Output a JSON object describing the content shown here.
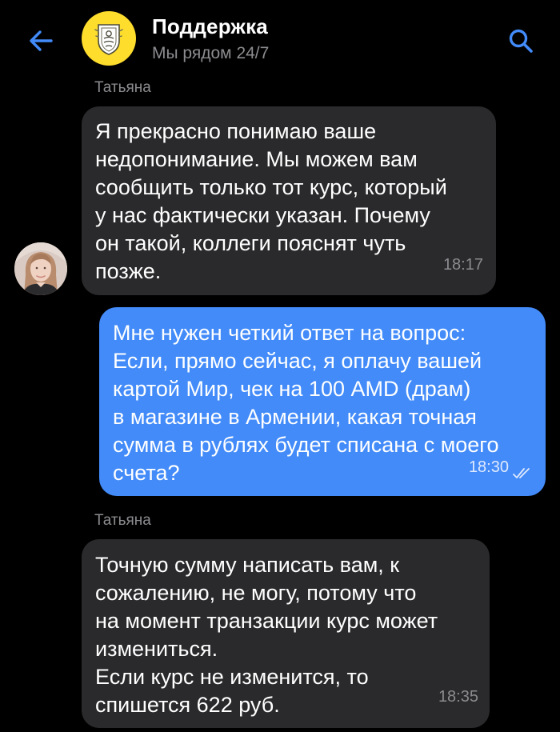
{
  "header": {
    "title": "Поддержка",
    "subtitle": "Мы рядом 24/7",
    "back_icon": "arrow-left-icon",
    "search_icon": "search-icon",
    "accent_color": "#428bf9",
    "logo_color": "#ffdd2d"
  },
  "messages": [
    {
      "direction": "incoming",
      "sender": "Татьяна",
      "text": "Я прекрасно понимаю ваше\nнедопонимание. Мы можем вам\nсообщить только тот курс, который\nу нас фактически указан. Почему\nон такой, коллеги пояснят чуть\nпозже.",
      "time": "18:17"
    },
    {
      "direction": "outgoing",
      "text": "Мне нужен четкий ответ на вопрос:\nЕсли, прямо сейчас, я оплачу вашей\nкартой Мир, чек на 100 AMD (драм)\nв магазине в Армении, какая точная\nсумма в рублях будет списана с моего\nсчета?",
      "time": "18:30",
      "status_icon": "double-check-icon"
    },
    {
      "direction": "incoming",
      "sender": "Татьяна",
      "text": "Точную сумму написать вам, к\nсожалению, не могу, потому что\nна момент транзакции курс может\nизмениться.\nЕсли курс не изменится, то\nспишется 622 руб.",
      "time": "18:35"
    }
  ]
}
